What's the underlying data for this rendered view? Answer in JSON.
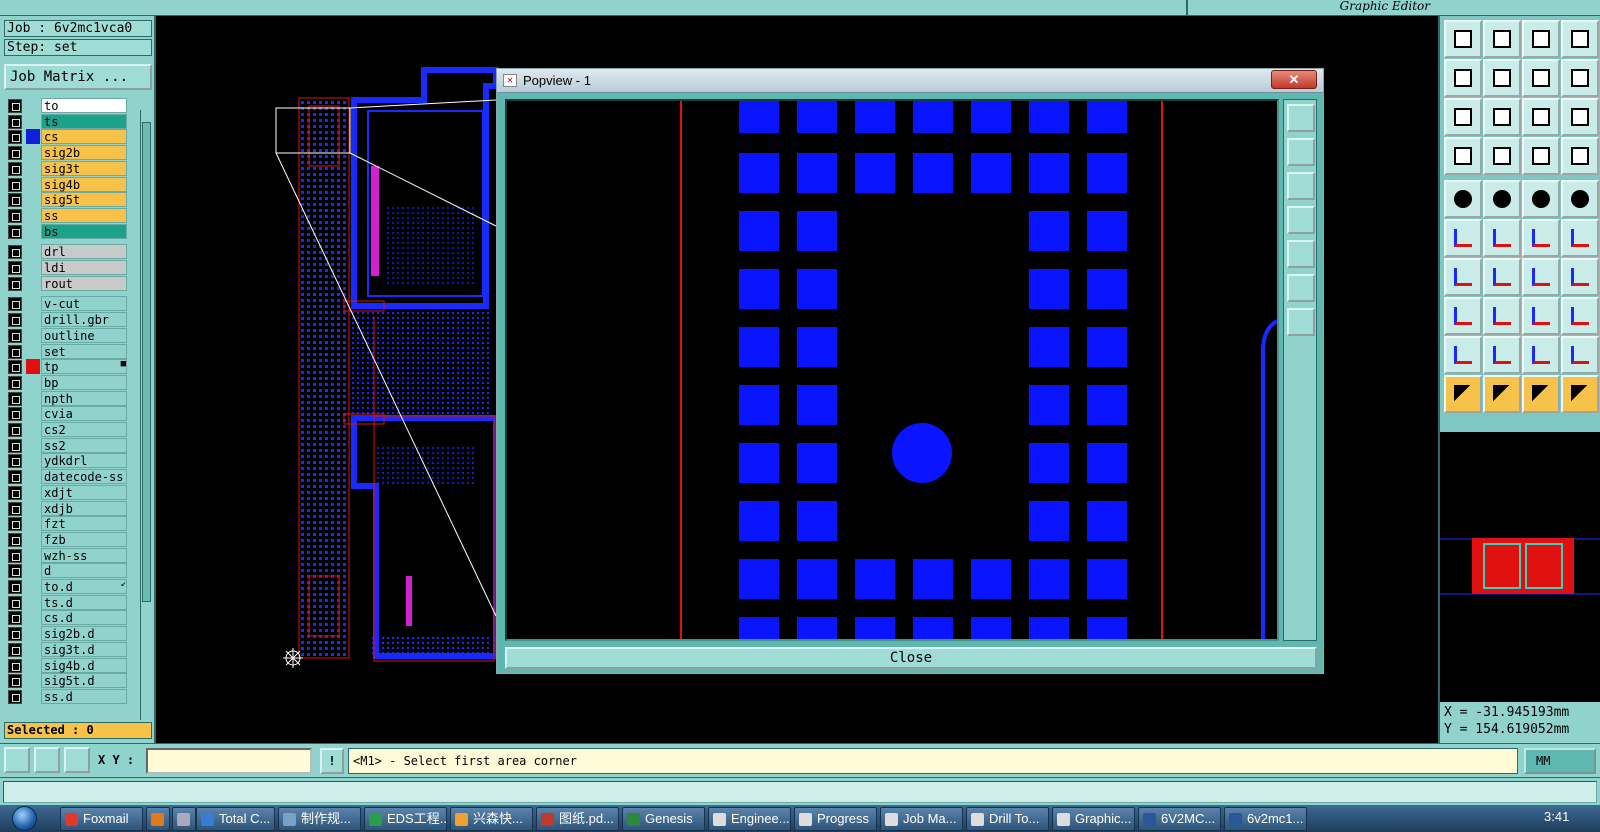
{
  "header": {
    "brand": "Graphic Editor"
  },
  "job": {
    "job_line": "Job : 6v2mc1vca0",
    "step_line": "Step: set",
    "matrix_button": "Job Matrix ..."
  },
  "layers": [
    {
      "name": "to",
      "color": "#ffffff",
      "swatch": ""
    },
    {
      "name": "ts",
      "color": "#1aa38a",
      "swatch": ""
    },
    {
      "name": "cs",
      "color": "#f6c24a",
      "swatch": "#1020d8"
    },
    {
      "name": "sig2b",
      "color": "#f6c24a",
      "swatch": ""
    },
    {
      "name": "sig3t",
      "color": "#f6c24a",
      "swatch": ""
    },
    {
      "name": "sig4b",
      "color": "#f6c24a",
      "swatch": ""
    },
    {
      "name": "sig5t",
      "color": "#f6c24a",
      "swatch": ""
    },
    {
      "name": "ss",
      "color": "#f6c24a",
      "swatch": ""
    },
    {
      "name": "bs",
      "color": "#1aa38a",
      "swatch": ""
    },
    {
      "name": "drl",
      "color": "#c9c9c9",
      "swatch": ""
    },
    {
      "name": "ldi",
      "color": "#c9c9c9",
      "swatch": ""
    },
    {
      "name": "rout",
      "color": "#c9c9c9",
      "swatch": ""
    },
    {
      "name": "v-cut",
      "color": "#8fd3cc",
      "swatch": ""
    },
    {
      "name": "drill.gbr",
      "color": "#8fd3cc",
      "swatch": ""
    },
    {
      "name": "outline",
      "color": "#8fd3cc",
      "swatch": ""
    },
    {
      "name": "set",
      "color": "#8fd3cc",
      "swatch": ""
    },
    {
      "name": "tp",
      "color": "#8fd3cc",
      "swatch": "#e01010",
      "mark": "■"
    },
    {
      "name": "bp",
      "color": "#8fd3cc",
      "swatch": ""
    },
    {
      "name": "npth",
      "color": "#8fd3cc",
      "swatch": ""
    },
    {
      "name": "cvia",
      "color": "#8fd3cc",
      "swatch": ""
    },
    {
      "name": "cs2",
      "color": "#8fd3cc",
      "swatch": ""
    },
    {
      "name": "ss2",
      "color": "#8fd3cc",
      "swatch": ""
    },
    {
      "name": "ydkdrl",
      "color": "#8fd3cc",
      "swatch": ""
    },
    {
      "name": "datecode-ss",
      "color": "#8fd3cc",
      "swatch": ""
    },
    {
      "name": "xdjt",
      "color": "#8fd3cc",
      "swatch": ""
    },
    {
      "name": "xdjb",
      "color": "#8fd3cc",
      "swatch": ""
    },
    {
      "name": "fzt",
      "color": "#8fd3cc",
      "swatch": ""
    },
    {
      "name": "fzb",
      "color": "#8fd3cc",
      "swatch": ""
    },
    {
      "name": "wzh-ss",
      "color": "#8fd3cc",
      "swatch": ""
    },
    {
      "name": "d",
      "color": "#8fd3cc",
      "swatch": ""
    },
    {
      "name": "to.d",
      "color": "#8fd3cc",
      "swatch": "",
      "mark": "↙"
    },
    {
      "name": "ts.d",
      "color": "#8fd3cc",
      "swatch": ""
    },
    {
      "name": "cs.d",
      "color": "#8fd3cc",
      "swatch": ""
    },
    {
      "name": "sig2b.d",
      "color": "#8fd3cc",
      "swatch": ""
    },
    {
      "name": "sig3t.d",
      "color": "#8fd3cc",
      "swatch": ""
    },
    {
      "name": "sig4b.d",
      "color": "#8fd3cc",
      "swatch": ""
    },
    {
      "name": "sig5t.d",
      "color": "#8fd3cc",
      "swatch": ""
    },
    {
      "name": "ss.d",
      "color": "#8fd3cc",
      "swatch": ""
    }
  ],
  "selected": "Selected : 0",
  "popview": {
    "title": "Popview - 1",
    "close_x": "✕",
    "close_button": "Close"
  },
  "right_toolbar": {
    "rows": [
      [
        "home-top-icon",
        "home-bottom-icon",
        "home-icon",
        "fit-icon"
      ],
      [
        "pan-left-icon",
        "pan-right-icon",
        "undo-view-icon",
        "redraw-icon"
      ],
      [
        "zoom-fit-icon",
        "zoom-center-icon",
        "scale-1-2-icon",
        "help-icon"
      ],
      [
        "settings-icon",
        "grid-icon",
        "layer-swap-icon",
        "layer-swap2-icon"
      ],
      [
        "snap-icon",
        "select-area-icon",
        "ruler-icon",
        "pad-icon"
      ],
      [
        "connect-icon",
        "delete-icon",
        "line-add-icon",
        "arc-add-icon"
      ],
      [
        "angle-icon",
        "slope-icon",
        "rotate-icon",
        "mirror-icon"
      ],
      [
        "pad-move-icon",
        "line-icon",
        "measure-icon",
        "group-icon"
      ],
      [
        "shape-a-icon",
        "shape-b-icon",
        "shape-c-icon",
        "shape-d-icon"
      ],
      [
        "pointer-icon",
        "pointer-area-icon",
        "pointer-net-icon",
        "pointer-route-icon"
      ]
    ]
  },
  "coords": {
    "x": "X = -31.945193mm",
    "y": "Y = 154.619052mm"
  },
  "command": {
    "xy_label": "X Y :",
    "xy_value": "",
    "bang": "!",
    "prompt": "<M1> - Select first area corner",
    "units": "MM"
  },
  "taskbar": {
    "items": [
      "Foxmail",
      "",
      "",
      "Total C...",
      "制作规...",
      "EDS工程...",
      "兴森快...",
      "图纸.pd...",
      "Genesis",
      "Enginee...",
      "Progress",
      "Job Ma...",
      "Drill To...",
      "Graphic...",
      "6V2MC...",
      "6v2mc1..."
    ],
    "clock": "3:41"
  },
  "colors": {
    "panel": "#8fd3cc",
    "copper": "#0a14ff",
    "board_outline": "#e01010",
    "accent": "#f6c24a"
  }
}
